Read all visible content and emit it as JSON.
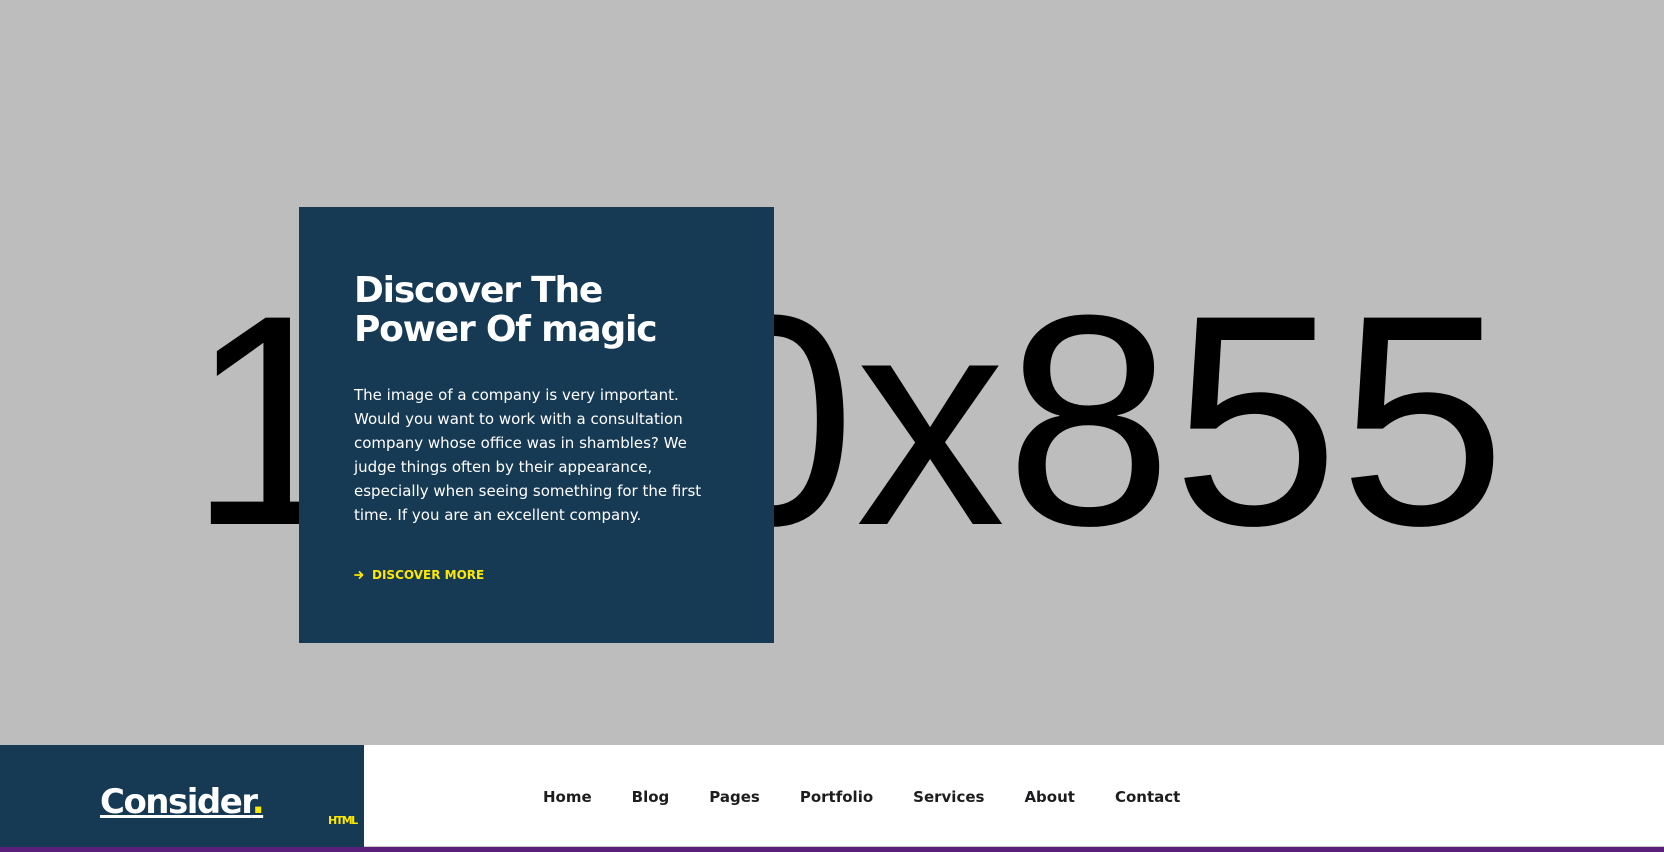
{
  "hero": {
    "placeholder_text": "1920x855"
  },
  "feature": {
    "title": "Discover The Power Of magic",
    "body": "The image of a company is very important. Would you want to work with a consultation company whose office was in shambles? We judge things often by their appearance, especially when seeing something for the first time. If you are an excellent company.",
    "cta_label": "DISCOVER MORE",
    "cta_icon": "arrow-right-icon"
  },
  "brand": {
    "name": "Consider",
    "dot": ".",
    "badge": "HTML"
  },
  "navigation": {
    "items": [
      {
        "label": "Home"
      },
      {
        "label": "Blog"
      },
      {
        "label": "Pages"
      },
      {
        "label": "Portfolio"
      },
      {
        "label": "Services"
      },
      {
        "label": "About"
      },
      {
        "label": "Contact"
      }
    ]
  },
  "colors": {
    "hero_background": "#bdbdbd",
    "card_background": "#173a54",
    "accent": "#ffe800",
    "nav_background": "#ffffff",
    "bottom_strip": "#5a1f7a"
  }
}
